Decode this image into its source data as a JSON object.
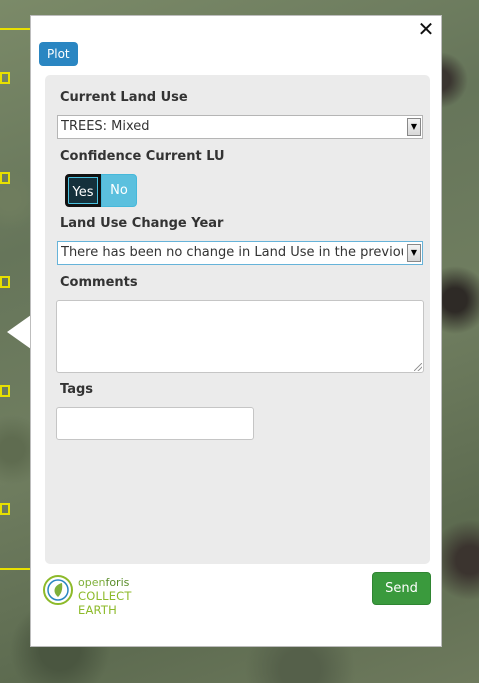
{
  "popup": {
    "close_label": "✕",
    "tab_label": "Plot"
  },
  "form": {
    "current_land_use": {
      "label": "Current Land Use",
      "selected": "TREES: Mixed"
    },
    "confidence": {
      "label": "Confidence Current LU",
      "yes_label": "Yes",
      "no_label": "No",
      "selected": "Yes"
    },
    "change_year": {
      "label": "Land Use Change Year",
      "selected": "There has been no change in Land Use in the previous"
    },
    "comments": {
      "label": "Comments",
      "value": ""
    },
    "tags": {
      "label": "Tags",
      "value": ""
    }
  },
  "footer": {
    "logo_top_prefix": "open",
    "logo_top_suffix": "foris",
    "logo_bottom": "COLLECT EARTH",
    "send_label": "Send"
  },
  "colors": {
    "tab": "#2a86c2",
    "send": "#3a9a3d",
    "yes_active": "#14303b",
    "no": "#5bc0de",
    "plot_outline": "#e8e000"
  }
}
